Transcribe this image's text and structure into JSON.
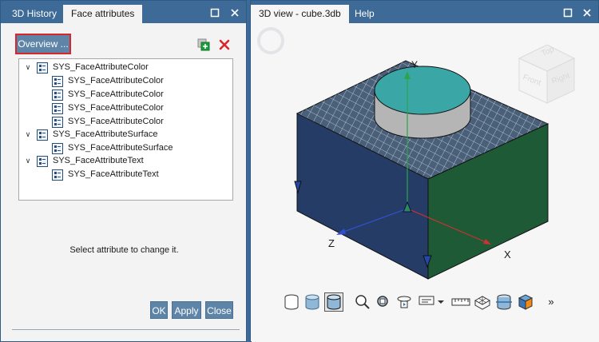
{
  "left_panel": {
    "tabs": [
      {
        "label": "3D History"
      },
      {
        "label": "Face attributes"
      }
    ],
    "overview_label": "Overview ...",
    "tree": [
      {
        "label": "SYS_FaceAttributeColor",
        "level": 0,
        "expanded": true
      },
      {
        "label": "SYS_FaceAttributeColor",
        "level": 1
      },
      {
        "label": "SYS_FaceAttributeColor",
        "level": 1
      },
      {
        "label": "SYS_FaceAttributeColor",
        "level": 1
      },
      {
        "label": "SYS_FaceAttributeColor",
        "level": 1
      },
      {
        "label": "SYS_FaceAttributeSurface",
        "level": 0,
        "expanded": true
      },
      {
        "label": "SYS_FaceAttributeSurface",
        "level": 1
      },
      {
        "label": "SYS_FaceAttributeText",
        "level": 0,
        "expanded": true
      },
      {
        "label": "SYS_FaceAttributeText",
        "level": 1
      }
    ],
    "hint": "Select attribute to change it.",
    "buttons": {
      "ok": "OK",
      "apply": "Apply",
      "close": "Close"
    }
  },
  "right_panel": {
    "tabs": [
      {
        "label": "3D view - cube.3db"
      },
      {
        "label": "Help"
      }
    ],
    "viewcube": {
      "top": "Top",
      "front": "Front",
      "right": "Right"
    },
    "axes": {
      "x": "X",
      "y": "Y",
      "z": "Z"
    },
    "more_label": "»"
  },
  "colors": {
    "frame": "#3d6a96",
    "button": "#5e84a8",
    "cube_top": "#4a5f78",
    "cube_front": "#243c66",
    "cube_right": "#1f5a36",
    "cylinder_top": "#3aa7a6",
    "cylinder_side": "#b5b5b5"
  }
}
